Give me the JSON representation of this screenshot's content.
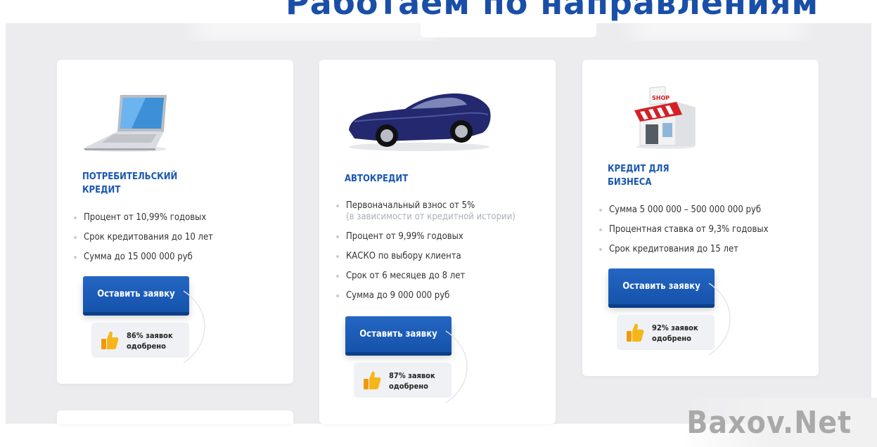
{
  "section": {
    "title": "Работаем по направлениям:"
  },
  "cards": [
    {
      "title_line1": "Потребительский",
      "title_line2": "кредит",
      "icon": "laptop-icon",
      "features": [
        "Процент от 10,99% годовых",
        "Срок кредитования до 10 лет",
        "Сумма до 15 000 000 руб"
      ],
      "button": "Оставить заявку",
      "approved_line1": "86% заявок",
      "approved_line2": "одобрено"
    },
    {
      "title_line1": "Автокредит",
      "icon": "car-icon",
      "features": [
        {
          "text": "Первоначальный взнос от 5%",
          "note": "(в зависимости от кредитной истории)"
        },
        "Процент от 9,99% годовых",
        "КАСКО по выбору клиента",
        "Срок от 6 месяцев до 8 лет",
        "Сумма до 9 000 000 руб"
      ],
      "button": "Оставить заявку",
      "approved_line1": "87% заявок",
      "approved_line2": "одобрено"
    },
    {
      "title_line1": "Кредит для",
      "title_line2": "бизнеса",
      "icon": "shop-icon",
      "shop_sign": "SHOP",
      "features": [
        "Сумма 5 000 000 – 500 000 000 руб",
        "Процентная ставка от 9,3% годовых",
        "Срок кредитования до 15 лет"
      ],
      "button": "Оставить заявку",
      "approved_line1": "92% заявок",
      "approved_line2": "одобрено"
    }
  ],
  "watermark": "Baxov.Net",
  "colors": {
    "accent": "#1a57b0",
    "button": "#1553ab",
    "background": "#ececef"
  }
}
